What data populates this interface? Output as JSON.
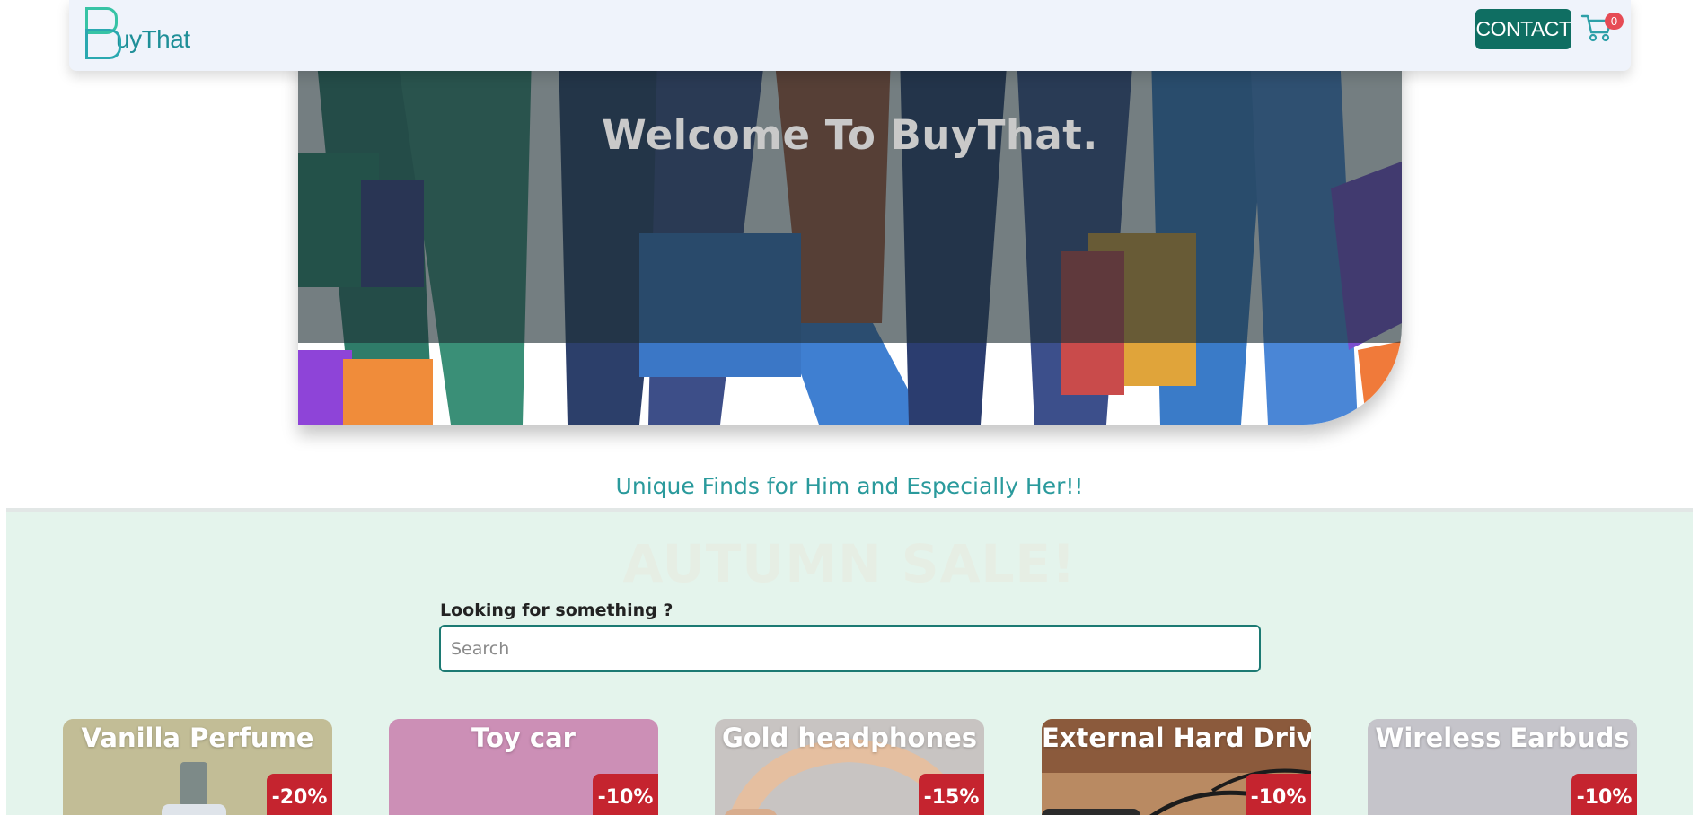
{
  "brand": {
    "logo_text": "uyThat"
  },
  "nav": {
    "contact_label": "CONTACT",
    "cart_count": "0"
  },
  "hero": {
    "title": "Welcome To BuyThat."
  },
  "tagline": "Unique Finds for Him and Especially Her!!",
  "sale": {
    "title": "AUTUMN SALE!",
    "search_label": "Looking for something ?",
    "search_placeholder": "Search",
    "search_value": ""
  },
  "products": [
    {
      "name": "Vanilla Perfume",
      "discount": "-20%"
    },
    {
      "name": "Toy car",
      "discount": "-10%"
    },
    {
      "name": "Gold headphones",
      "discount": "-15%"
    },
    {
      "name": "External Hard Drive",
      "discount": "-10%"
    },
    {
      "name": "Wireless Earbuds",
      "discount": "-10%"
    }
  ],
  "colors": {
    "accent": "#0f6e62",
    "badge": "#c5242f",
    "cart_badge": "#e64b55",
    "sale_bg": "#e4f4ec",
    "navbar_bg": "#eff3fb"
  }
}
